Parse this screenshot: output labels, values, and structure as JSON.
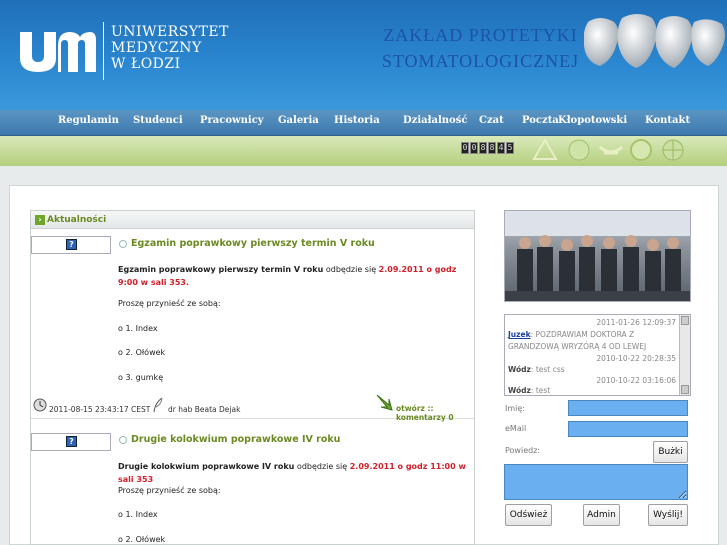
{
  "header": {
    "logo_lines": [
      "UNIWERSYTET",
      "MEDYCZNY",
      "W ŁODZI"
    ],
    "department": "ZAKŁAD PROTETYKI STOMATOLOGICZNEJ"
  },
  "nav": [
    "Regulamin",
    "Studenci",
    "Pracownicy",
    "Galeria",
    "Historia",
    "Działalność",
    "Czat",
    "Poczta",
    "Kłopotowski",
    "Kontakt"
  ],
  "counter": [
    "0",
    "0",
    "8",
    "8",
    "4",
    "5"
  ],
  "news_header": "Aktualności",
  "news": [
    {
      "title": "Egzamin poprawkowy pierwszy termin V roku",
      "lead_bold": "Egzamin poprawkowy pierwszy termin V roku",
      "lead_mid": " odbędzie się ",
      "lead_red": "2.09.2011 o godz 9:00 w sali 353.",
      "intro": "Proszę przynieść ze sobą:",
      "items": [
        "o 1. Index",
        "o 2. Ołówek",
        "o 3. gumkę"
      ],
      "date": "2011-08-15 23:43:17 CEST",
      "author": "dr hab Beata Dejak",
      "actions": "otwórz :: komentarzy 0"
    },
    {
      "title": "Drugie kolokwium poprawkowe IV roku",
      "lead_bold": "Drugie kolokwium poprawkowe IV roku",
      "lead_mid": " odbędzie się ",
      "lead_red": "2.09.2011 o godz 11:00 w sali 353",
      "intro": "Proszę przynieść ze sobą:",
      "items": [
        "o 1. Index",
        "o 2. Ołówek"
      ]
    }
  ],
  "chat": {
    "messages": [
      {
        "time": "2011-01-26 12:09:37",
        "user": "Juzek",
        "text": ": POZDRAWIAM DOKTORA Z GRANDZOWĄ WRYZÓRĄ 4 OD LEWEJ"
      },
      {
        "time": "2010-10-22 20:28:35",
        "user": "Wódz",
        "text": ": test css"
      },
      {
        "time": "2010-10-22 03:16:06",
        "user": "Wódz",
        "text": ": test"
      }
    ]
  },
  "form": {
    "name_label": "Imię:",
    "email_label": "eMail",
    "say_label": "Powiedz:",
    "emoji_btn": "Bużki",
    "refresh_btn": "Odśwież",
    "admin_btn": "Admin",
    "send_btn": "Wyślij!"
  }
}
